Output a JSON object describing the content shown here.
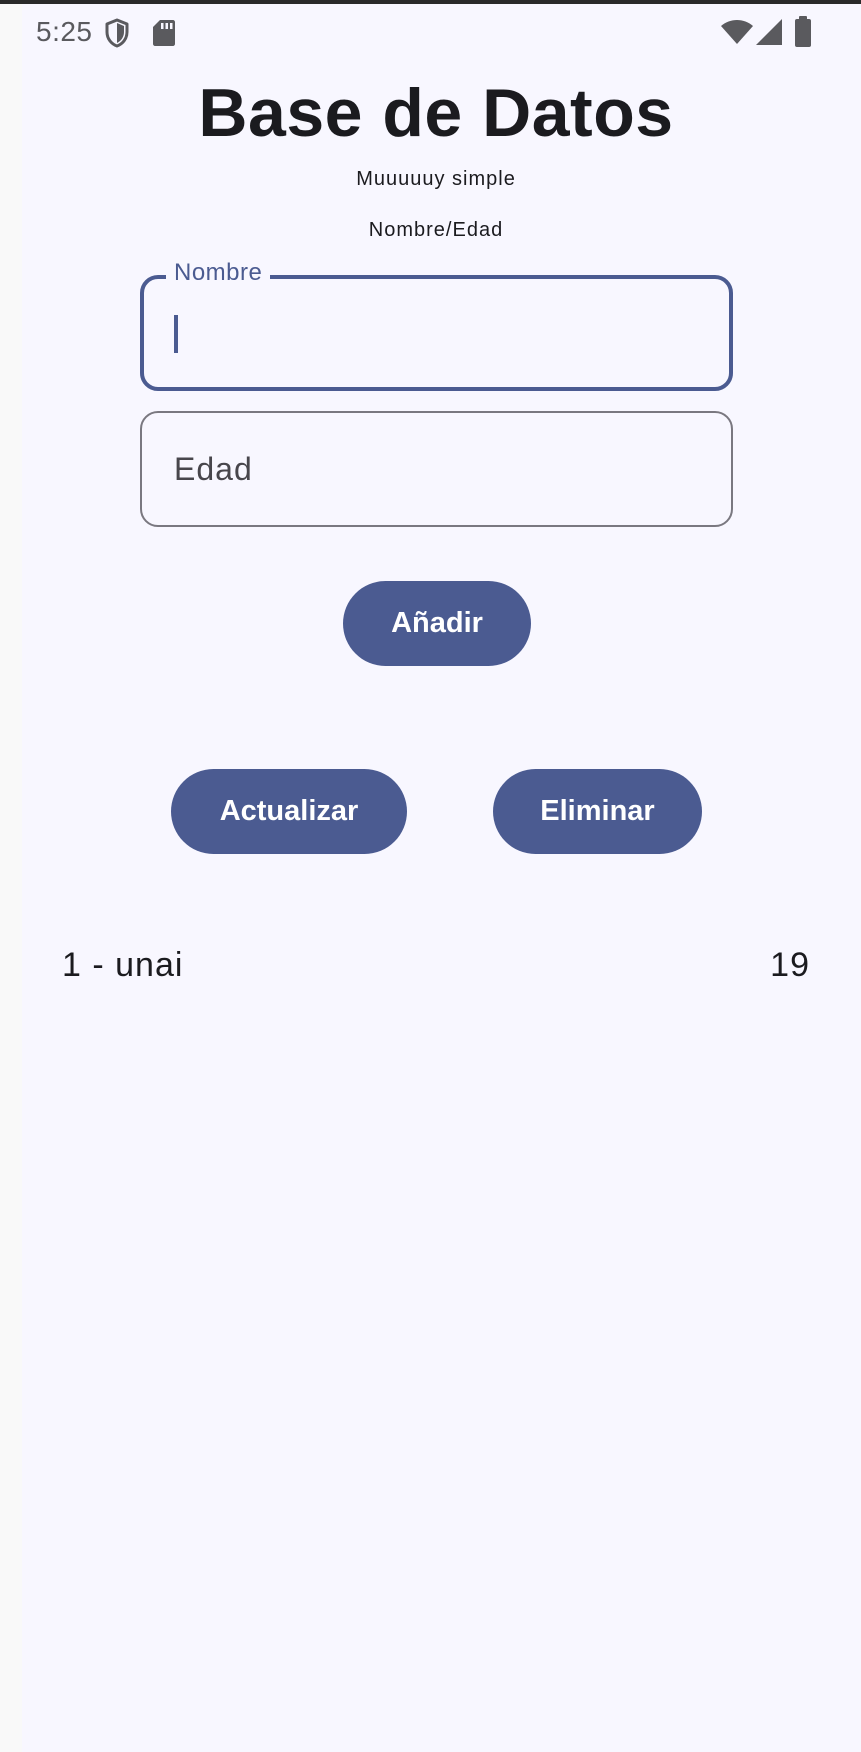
{
  "status_bar": {
    "time": "5:25",
    "icons": [
      "shield-icon",
      "sd-card-icon",
      "wifi-icon",
      "signal-icon",
      "battery-icon"
    ]
  },
  "header": {
    "title": "Base de Datos",
    "subtitle": "Muuuuuy simple",
    "fields_hint": "Nombre/Edad"
  },
  "form": {
    "nombre": {
      "label": "Nombre",
      "value": ""
    },
    "edad": {
      "placeholder": "Edad",
      "value": ""
    }
  },
  "buttons": {
    "add_label": "Añadir",
    "update_label": "Actualizar",
    "delete_label": "Eliminar"
  },
  "records": [
    {
      "label": "1 - unai",
      "age": "19"
    }
  ],
  "colors": {
    "primary": "#4b5b91",
    "surface": "#f8f7ff",
    "on_surface": "#1b1b1f",
    "outline": "#7a7880"
  }
}
